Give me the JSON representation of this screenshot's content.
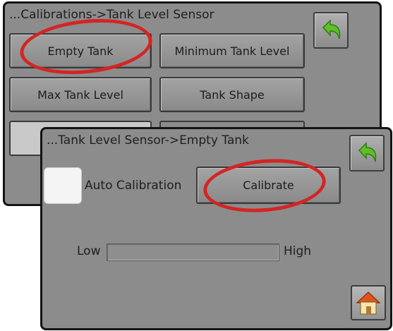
{
  "background_screen": {
    "title": "...Calibrations->Tank Level Sensor",
    "buttons": {
      "empty_tank": "Empty Tank",
      "minimum_tank_level": "Minimum Tank Level",
      "max_tank_level": "Max Tank Level",
      "tank_shape": "Tank Shape"
    },
    "back_icon": "back-arrow-icon"
  },
  "foreground_screen": {
    "title": "...Tank Level Sensor->Empty Tank",
    "auto_calibration_label": "Auto Calibration",
    "auto_calibration_checked": false,
    "calibrate_label": "Calibrate",
    "level": {
      "low_label": "Low",
      "high_label": "High",
      "fraction": 0
    },
    "back_icon": "back-arrow-icon",
    "home_icon": "home-icon"
  },
  "colors": {
    "screen_bg": "#8c8c8c",
    "highlight": "#d42424",
    "back_arrow": "#5fbf2a",
    "home_roof": "#e0531c"
  }
}
